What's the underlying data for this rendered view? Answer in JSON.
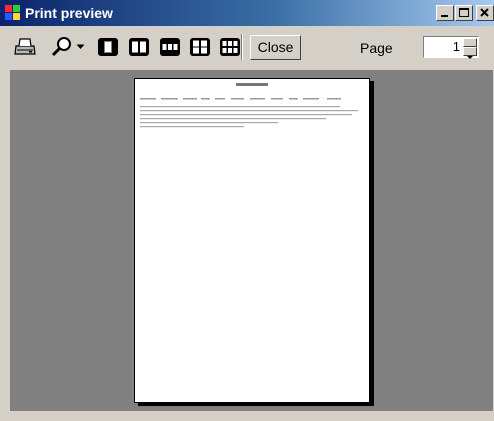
{
  "window": {
    "title": "Print preview",
    "caption_buttons": [
      "minimize-icon",
      "maximize-icon",
      "close-icon"
    ]
  },
  "toolbar": {
    "buttons": [
      "print-icon",
      "zoom-icon",
      "dropdown-arrow-icon",
      "one-page-icon",
      "two-pages-icon",
      "three-pages-icon",
      "four-pages-icon",
      "six-pages-icon"
    ],
    "close_label": "Close",
    "page_label": "Page",
    "page_value": "1"
  },
  "colors": {
    "titlebar_start": "#0a246a",
    "titlebar_end": "#a6caf0",
    "face": "#d4d0c8",
    "preview_background": "#808080",
    "paper": "#ffffff"
  }
}
